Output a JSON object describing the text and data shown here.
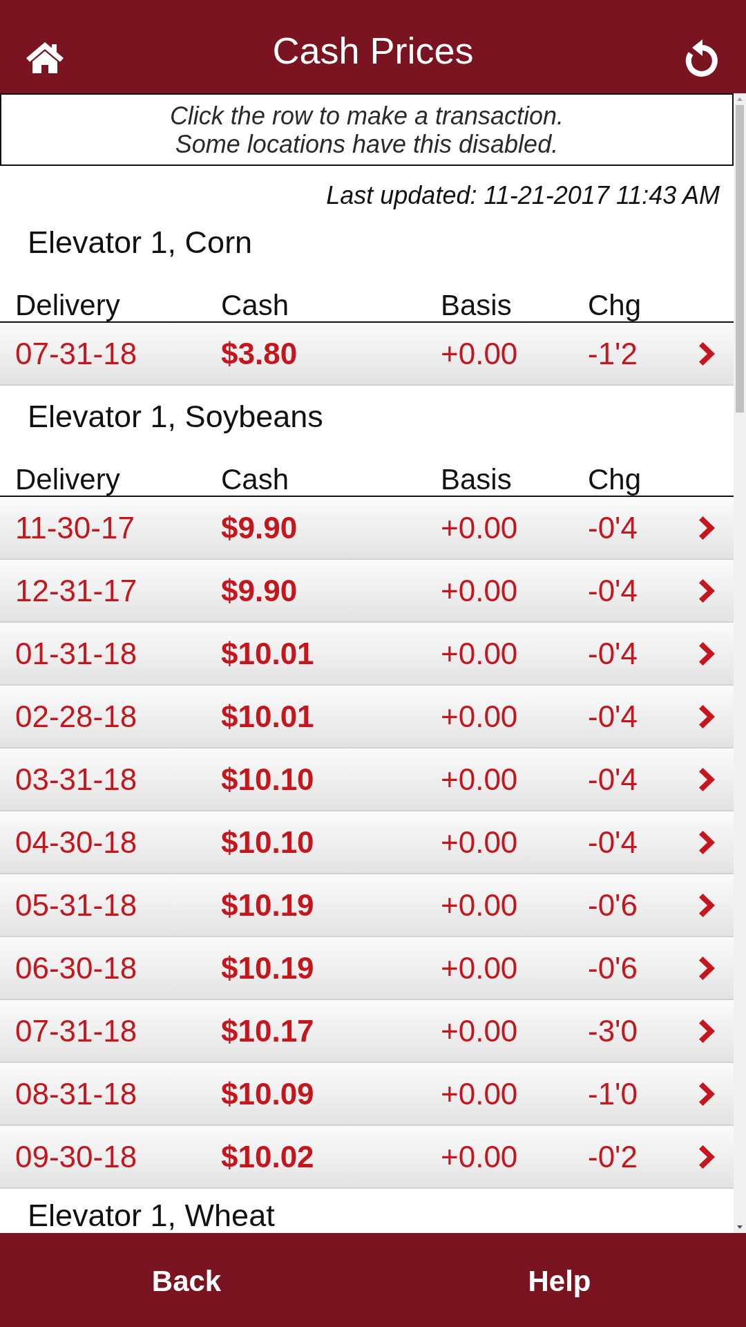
{
  "header": {
    "title": "Cash Prices"
  },
  "notice": {
    "lines": [
      "Click the row to make a transaction.",
      "Some locations have this disabled."
    ]
  },
  "last_updated": "Last updated: 11-21-2017 11:43 AM",
  "sections": [
    {
      "title": "Elevator 1, Corn",
      "columns": [
        "Delivery",
        "Cash",
        "Basis",
        "Chg"
      ],
      "rows": [
        {
          "delivery": "07-31-18",
          "cash": "$3.80",
          "basis": "+0.00",
          "chg": "-1'2"
        }
      ]
    },
    {
      "title": "Elevator 1, Soybeans",
      "columns": [
        "Delivery",
        "Cash",
        "Basis",
        "Chg"
      ],
      "rows": [
        {
          "delivery": "11-30-17",
          "cash": "$9.90",
          "basis": "+0.00",
          "chg": "-0'4"
        },
        {
          "delivery": "12-31-17",
          "cash": "$9.90",
          "basis": "+0.00",
          "chg": "-0'4"
        },
        {
          "delivery": "01-31-18",
          "cash": "$10.01",
          "basis": "+0.00",
          "chg": "-0'4"
        },
        {
          "delivery": "02-28-18",
          "cash": "$10.01",
          "basis": "+0.00",
          "chg": "-0'4"
        },
        {
          "delivery": "03-31-18",
          "cash": "$10.10",
          "basis": "+0.00",
          "chg": "-0'4"
        },
        {
          "delivery": "04-30-18",
          "cash": "$10.10",
          "basis": "+0.00",
          "chg": "-0'4"
        },
        {
          "delivery": "05-31-18",
          "cash": "$10.19",
          "basis": "+0.00",
          "chg": "-0'6"
        },
        {
          "delivery": "06-30-18",
          "cash": "$10.19",
          "basis": "+0.00",
          "chg": "-0'6"
        },
        {
          "delivery": "07-31-18",
          "cash": "$10.17",
          "basis": "+0.00",
          "chg": "-3'0"
        },
        {
          "delivery": "08-31-18",
          "cash": "$10.09",
          "basis": "+0.00",
          "chg": "-1'0"
        },
        {
          "delivery": "09-30-18",
          "cash": "$10.02",
          "basis": "+0.00",
          "chg": "-0'2"
        }
      ]
    },
    {
      "title": "Elevator 1, Wheat"
    }
  ],
  "footer": {
    "buttons": [
      "Back",
      "Help"
    ]
  }
}
